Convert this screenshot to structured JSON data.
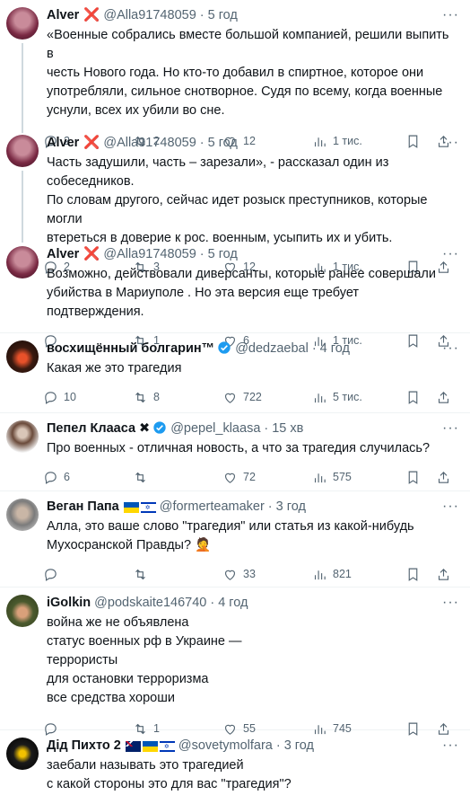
{
  "tweets": [
    {
      "name": "Alver",
      "mark": "❌",
      "handle": "@Alla91748059",
      "time": "5 год",
      "lines": [
        "«Военные собрались вместе большой компанией, решили выпить в",
        "честь Нового года. Но кто-то добавил в спиртное, которое они",
        "употребляли, сильное снотворное. Судя по всему, когда военные",
        "уснули, всех их убили во сне."
      ],
      "reply": "2",
      "retweet": "2",
      "like": "12",
      "views": "1 тис."
    },
    {
      "name": "Alver",
      "mark": "❌",
      "handle": "@Alla91748059",
      "time": "5 год",
      "lines": [
        "Часть задушили, часть – зарезали», - рассказал один из  собеседников.",
        "По словам другого, сейчас идет розыск преступников, которые могли",
        "втереться в доверие к рос. военным, усыпить их и убить."
      ],
      "reply": "2",
      "retweet": "3",
      "like": "12",
      "views": "1 тис."
    },
    {
      "name": "Alver",
      "mark": "❌",
      "handle": "@Alla91748059",
      "time": "5 год",
      "lines": [
        "Возможно, действовали диверсанты, которые ранее совершали",
        "убийства в Мариуполе . Но эта версия еще требует подтверждения."
      ],
      "reply": "",
      "retweet": "1",
      "like": "6",
      "views": "1 тис."
    },
    {
      "name": "восхищённый болгарин™",
      "handle": "@dedzaebal",
      "time": "4 год",
      "lines": [
        "Какая же это трагедия"
      ],
      "reply": "10",
      "retweet": "8",
      "like": "722",
      "views": "5 тис."
    },
    {
      "name": "Пепел Клааса",
      "handle": "@pepel_klaasa",
      "time": "15 хв",
      "lines": [
        "Про военных - отличная новость, а что за трагедия случилась?"
      ],
      "reply": "6",
      "retweet": "",
      "like": "72",
      "views": "575"
    },
    {
      "name": "Веган Папа",
      "handle": "@formerteamaker",
      "time": "3 год",
      "lines": [
        "Алла, это ваше слово \"трагедия\" или статья из какой-нибудь",
        "Мухосранской Правды? 🤦"
      ],
      "reply": "",
      "retweet": "",
      "like": "33",
      "views": "821"
    },
    {
      "name": "iGolkin",
      "handle": "@podskaite146740",
      "time": "4 год",
      "lines": [
        "война же не объявлена",
        "статус военных рф в Украине —",
        "террористы",
        "для остановки терроризма",
        "все средства хороши"
      ],
      "reply": "",
      "retweet": "1",
      "like": "55",
      "views": "745"
    },
    {
      "name": "Дід Пихто 2",
      "handle": "@sovetymolfara",
      "time": "3 год",
      "lines": [
        "заебали называть это трагедией",
        "с какой стороны это для вас \"трагедия\"?"
      ]
    }
  ]
}
